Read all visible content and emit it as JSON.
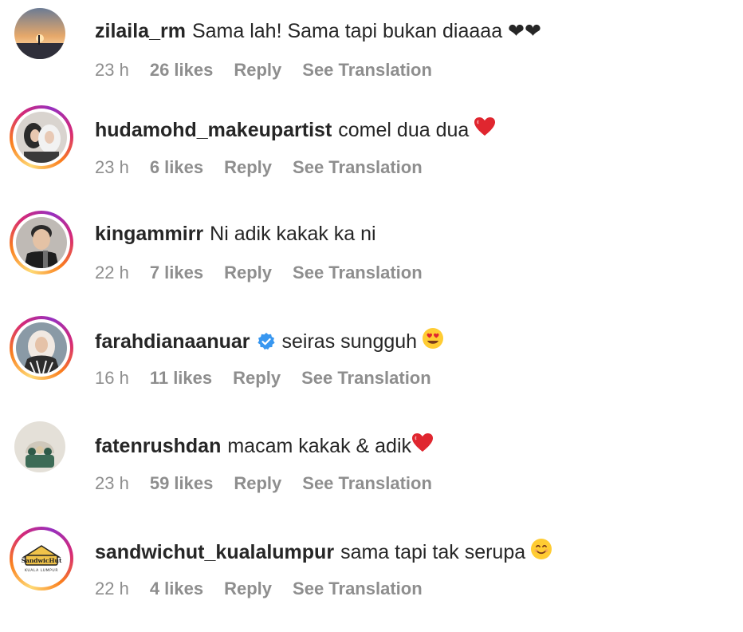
{
  "comments": [
    {
      "username": "zilaila_rm",
      "text": "Sama lah! Sama tapi bukan diaaaa ❤❤",
      "time": "23 h",
      "likes": "26 likes",
      "reply": "Reply",
      "translate": "See Translation",
      "story_ring": false,
      "verified": false
    },
    {
      "username": "hudamohd_makeupartist",
      "text": "comel dua dua",
      "emoji": "red-heart-emoji",
      "time": "23 h",
      "likes": "6 likes",
      "reply": "Reply",
      "translate": "See Translation",
      "story_ring": true,
      "verified": false
    },
    {
      "username": "kingammirr",
      "text": "Ni adik kakak ka ni",
      "time": "22 h",
      "likes": "7 likes",
      "reply": "Reply",
      "translate": "See Translation",
      "story_ring": true,
      "verified": false
    },
    {
      "username": "farahdianaanuar",
      "text": "seiras sungguh",
      "emoji": "heart-eyes-emoji",
      "time": "16 h",
      "likes": "11 likes",
      "reply": "Reply",
      "translate": "See Translation",
      "story_ring": true,
      "verified": true
    },
    {
      "username": "fatenrushdan",
      "text": "macam kakak & adik",
      "emoji": "red-heart-emoji",
      "time": "23 h",
      "likes": "59 likes",
      "reply": "Reply",
      "translate": "See Translation",
      "story_ring": false,
      "verified": false
    },
    {
      "username": "sandwichut_kualalumpur",
      "text": "sama tapi tak serupa",
      "emoji": "smiling-face-emoji",
      "time": "22 h",
      "likes": "4 likes",
      "reply": "Reply",
      "translate": "See Translation",
      "story_ring": true,
      "verified": false,
      "logo_text": "SandwicHut",
      "logo_subtext": "KUALA LUMPUR"
    }
  ],
  "colors": {
    "text": "#262626",
    "meta": "#8e8e8e",
    "verified": "#3897f0",
    "heart": "#ed4956"
  }
}
